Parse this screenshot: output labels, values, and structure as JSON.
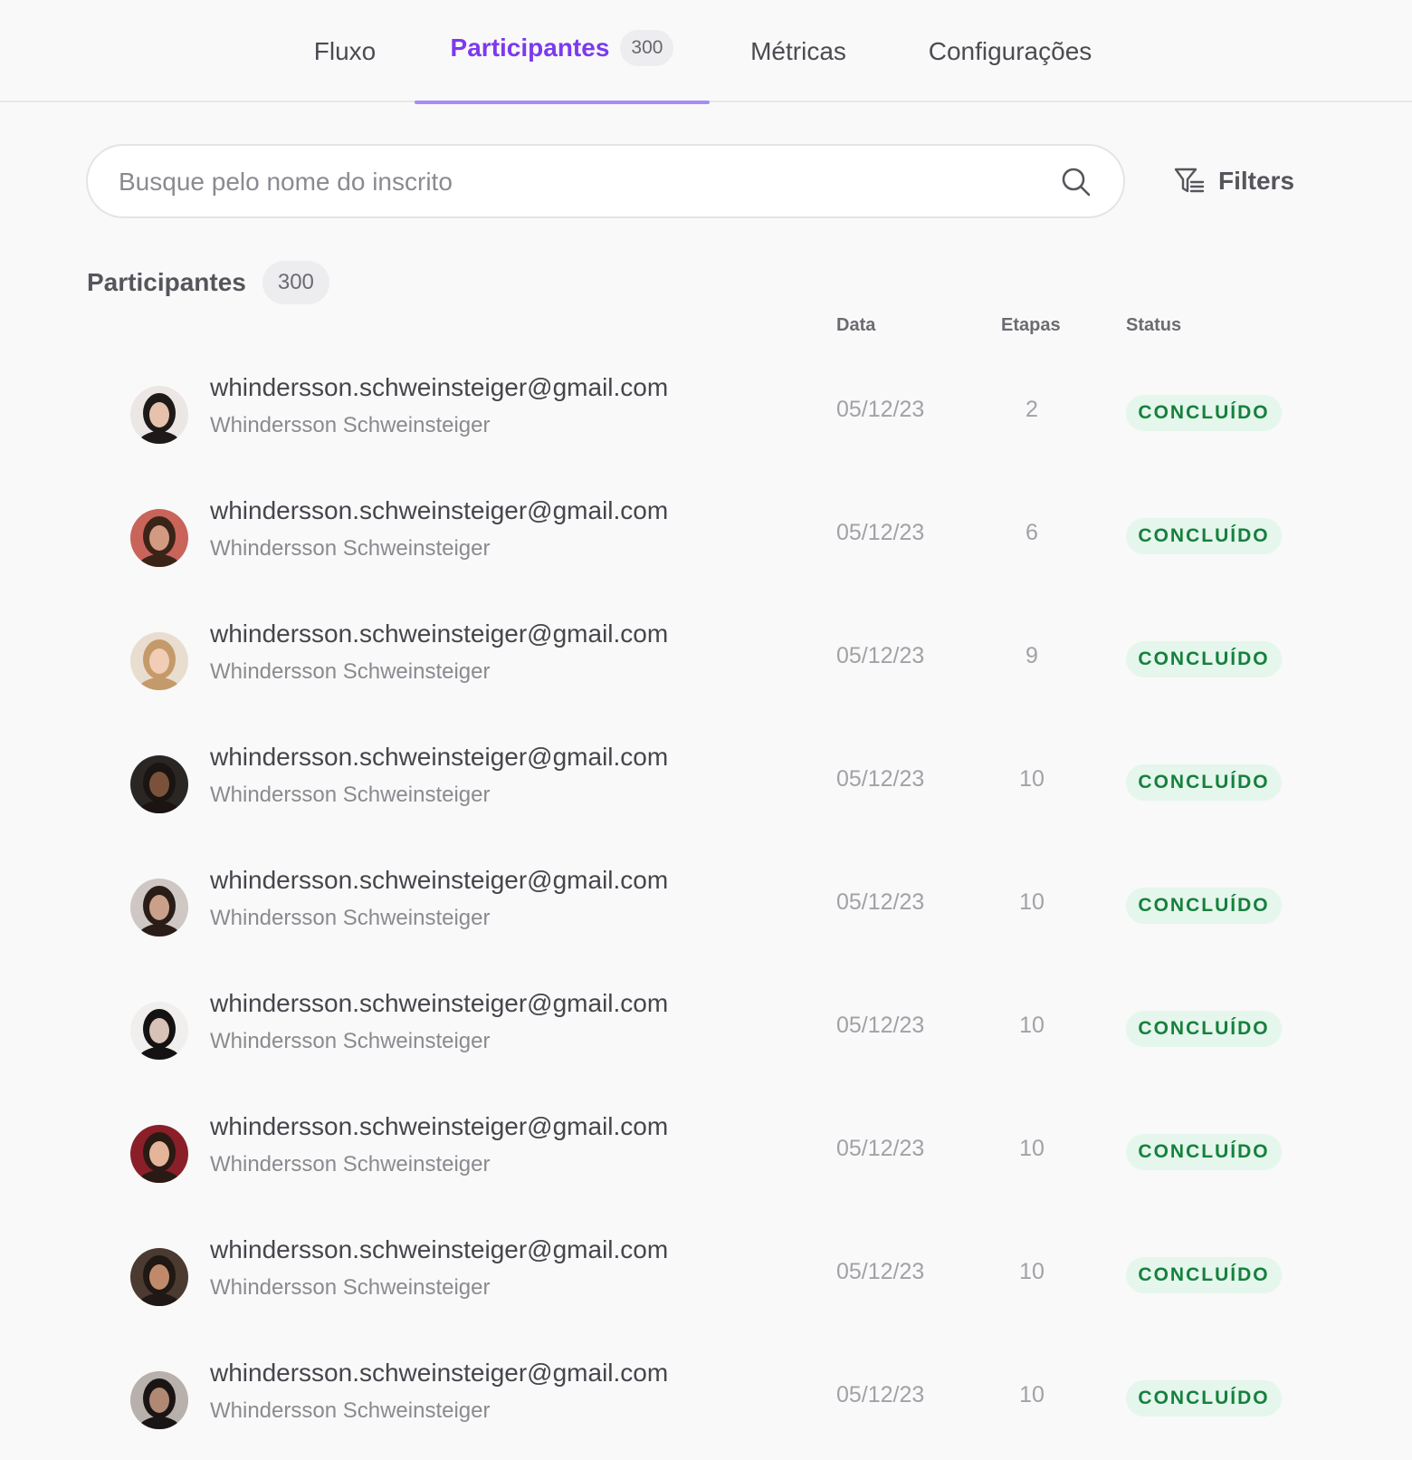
{
  "tabs": [
    {
      "label": "Fluxo"
    },
    {
      "label": "Participantes",
      "badge": "300"
    },
    {
      "label": "Métricas"
    },
    {
      "label": "Configurações"
    }
  ],
  "search": {
    "placeholder": "Busque pelo nome do inscrito",
    "value": ""
  },
  "filters": {
    "label": "Filters"
  },
  "section": {
    "title": "Participantes",
    "count": "300"
  },
  "columns": {
    "date": "Data",
    "steps": "Etapas",
    "status": "Status"
  },
  "colors": {
    "accent": "#7c3aed",
    "accent_underline": "#a78bfa",
    "status_text": "#15803d",
    "status_bg": "#e5f6ec"
  },
  "participants": [
    {
      "email": "whindersson.schweinsteiger@gmail.com",
      "name": "Whindersson Schweinsteiger",
      "date": "05/12/23",
      "steps": "2",
      "status": "CONCLUÍDO"
    },
    {
      "email": "whindersson.schweinsteiger@gmail.com",
      "name": "Whindersson Schweinsteiger",
      "date": "05/12/23",
      "steps": "6",
      "status": "CONCLUÍDO"
    },
    {
      "email": "whindersson.schweinsteiger@gmail.com",
      "name": "Whindersson Schweinsteiger",
      "date": "05/12/23",
      "steps": "9",
      "status": "CONCLUÍDO"
    },
    {
      "email": "whindersson.schweinsteiger@gmail.com",
      "name": "Whindersson Schweinsteiger",
      "date": "05/12/23",
      "steps": "10",
      "status": "CONCLUÍDO"
    },
    {
      "email": "whindersson.schweinsteiger@gmail.com",
      "name": "Whindersson Schweinsteiger",
      "date": "05/12/23",
      "steps": "10",
      "status": "CONCLUÍDO"
    },
    {
      "email": "whindersson.schweinsteiger@gmail.com",
      "name": "Whindersson Schweinsteiger",
      "date": "05/12/23",
      "steps": "10",
      "status": "CONCLUÍDO"
    },
    {
      "email": "whindersson.schweinsteiger@gmail.com",
      "name": "Whindersson Schweinsteiger",
      "date": "05/12/23",
      "steps": "10",
      "status": "CONCLUÍDO"
    },
    {
      "email": "whindersson.schweinsteiger@gmail.com",
      "name": "Whindersson Schweinsteiger",
      "date": "05/12/23",
      "steps": "10",
      "status": "CONCLUÍDO"
    },
    {
      "email": "whindersson.schweinsteiger@gmail.com",
      "name": "Whindersson Schweinsteiger",
      "date": "05/12/23",
      "steps": "10",
      "status": "CONCLUÍDO"
    }
  ]
}
